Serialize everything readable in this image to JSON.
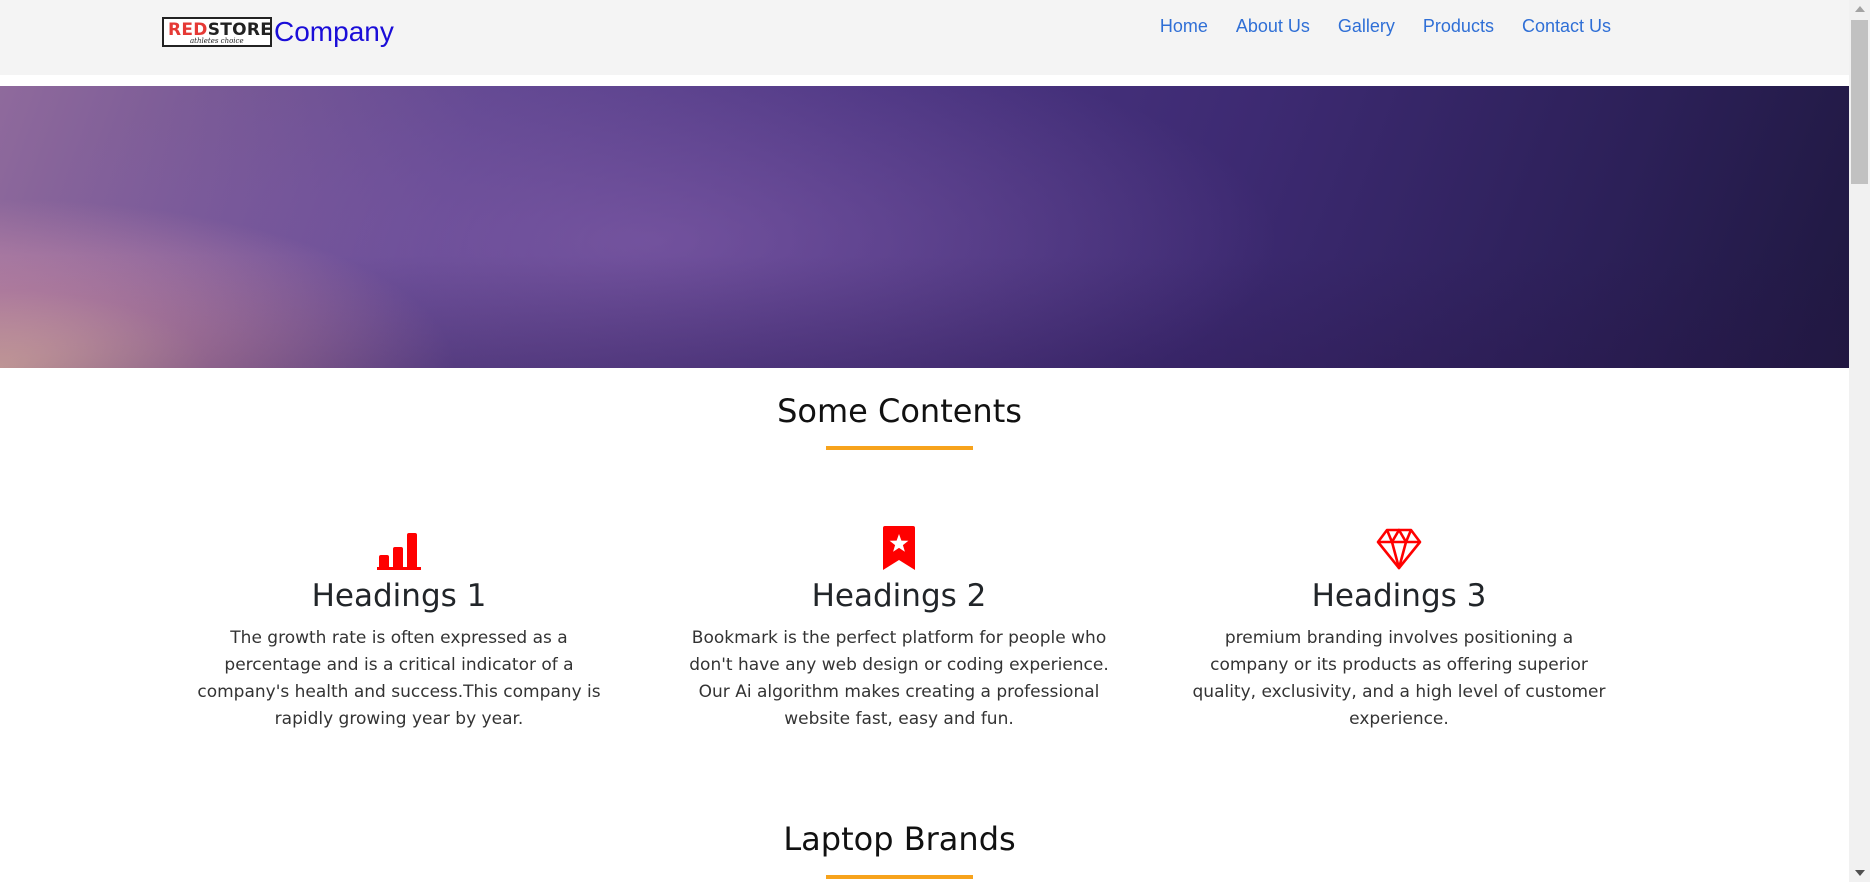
{
  "brand": {
    "logo_red": "RED",
    "logo_black": "STORE",
    "logo_tagline": "athletes choice",
    "name": "Company"
  },
  "nav": {
    "items": [
      "Home",
      "About Us",
      "Gallery",
      "Products",
      "Contact Us"
    ]
  },
  "sections": {
    "contents_title": "Some Contents",
    "brands_title": "Laptop Brands"
  },
  "cards": [
    {
      "icon": "bar-chart-icon",
      "heading": "Headings 1",
      "text": "The growth rate is often expressed as a percentage and is a critical indicator of a company's health and success.This company is rapidly growing year by year."
    },
    {
      "icon": "bookmark-star-icon",
      "heading": "Headings 2",
      "text": "Bookmark is the perfect platform for people who don't have any web design or coding experience. Our Ai algorithm makes creating a professional website fast, easy and fun."
    },
    {
      "icon": "gem-icon",
      "heading": "Headings 3",
      "text": "premium branding involves positioning a company or its products as offering superior quality, exclusivity, and a high level of customer experience."
    }
  ],
  "colors": {
    "accent_icon": "#ff0000",
    "underline": "#f7a31c",
    "nav_link": "#2f6fd6",
    "brand_name": "#1a0dd8"
  }
}
